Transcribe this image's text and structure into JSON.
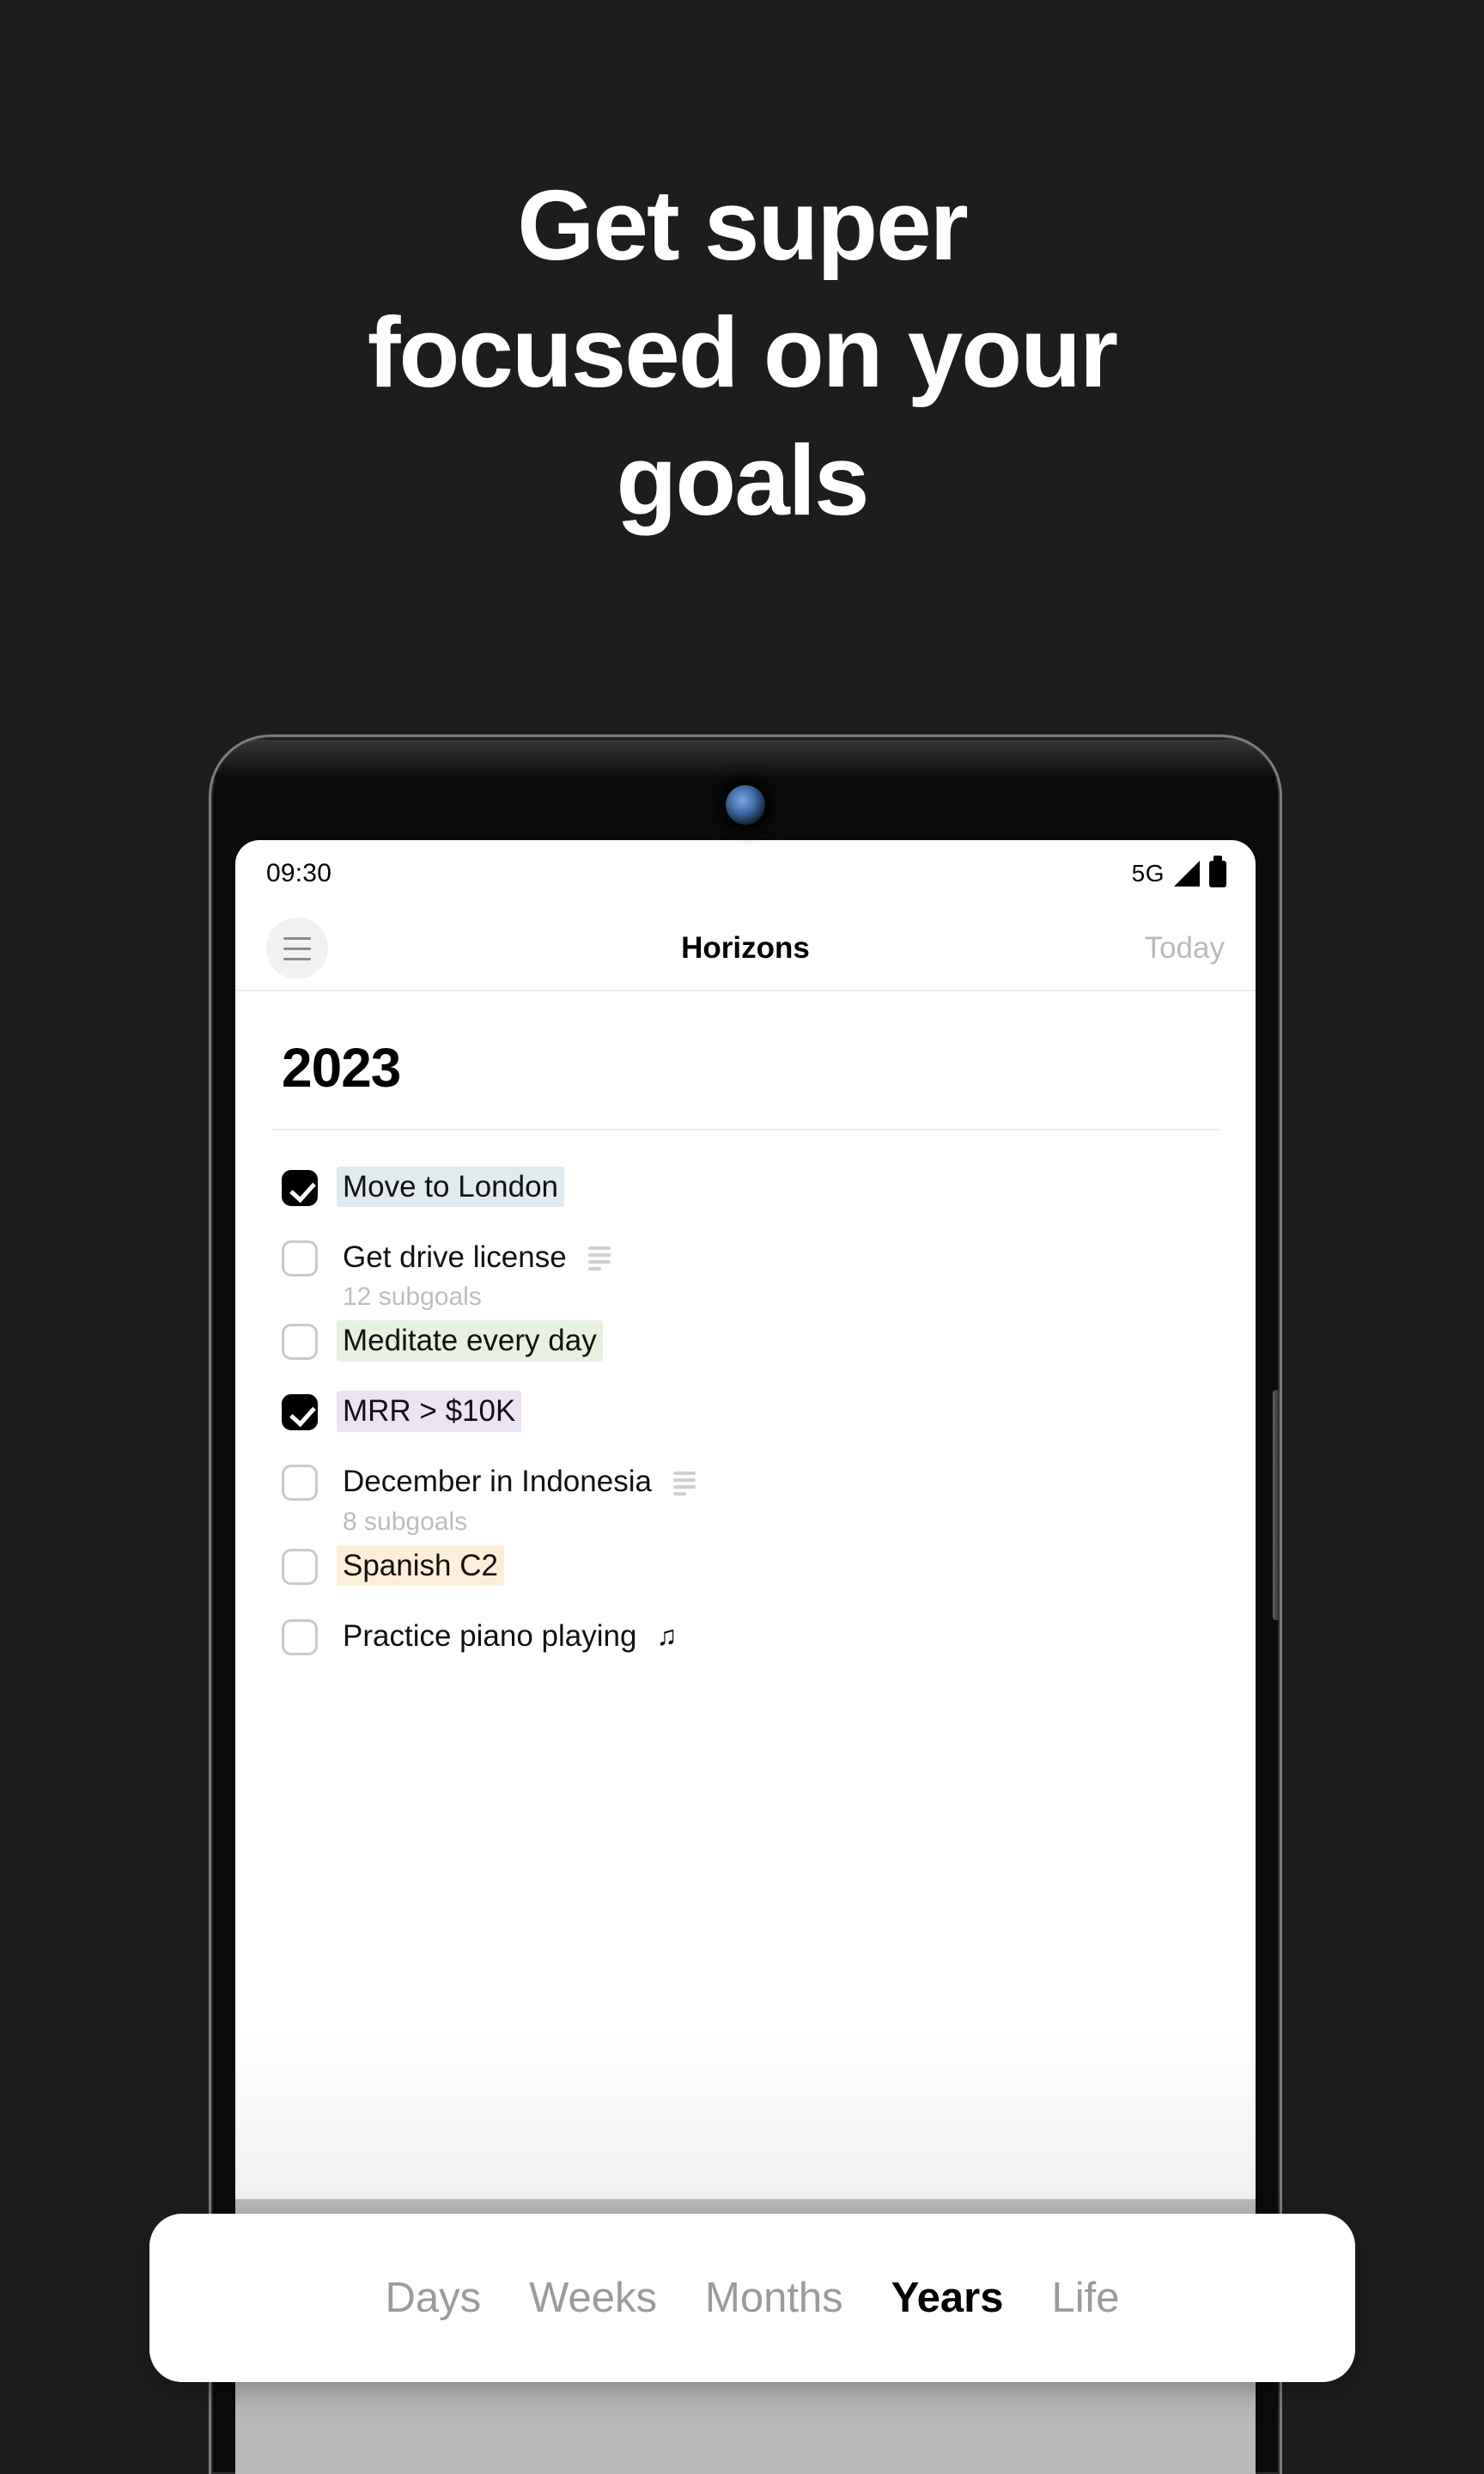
{
  "promo": {
    "headline_lines": [
      "Get super",
      "focused on your",
      "goals"
    ]
  },
  "phone": {
    "status_bar": {
      "time": "09:30",
      "network": "5G",
      "signal_icon": "signal-triangle-icon",
      "battery_icon": "battery-full-icon"
    },
    "nav_bar": {
      "menu_icon": "hamburger-menu-icon",
      "title": "Horizons",
      "action_label": "Today"
    },
    "content": {
      "year": "2023",
      "goals": [
        {
          "label": "Move to London",
          "checked": true,
          "highlight": "hl-blue",
          "subtitle": "",
          "badge": ""
        },
        {
          "label": "Get drive license",
          "checked": false,
          "highlight": "",
          "subtitle": "12 subgoals",
          "badge": "notes-icon"
        },
        {
          "label": "Meditate every day",
          "checked": false,
          "highlight": "hl-green",
          "subtitle": "",
          "badge": ""
        },
        {
          "label": "MRR > $10K",
          "checked": true,
          "highlight": "hl-purple",
          "subtitle": "",
          "badge": ""
        },
        {
          "label": "December in Indonesia",
          "checked": false,
          "highlight": "",
          "subtitle": "8 subgoals",
          "badge": "notes-icon"
        },
        {
          "label": "Spanish C2",
          "checked": false,
          "highlight": "hl-orange",
          "subtitle": "",
          "badge": ""
        },
        {
          "label": "Practice piano playing",
          "checked": false,
          "highlight": "",
          "subtitle": "",
          "badge": "music-note-icon",
          "badge_glyph": "♫"
        }
      ]
    },
    "camera_icon": "front-camera-icon",
    "side_button": "power-button"
  },
  "tabbar": {
    "tabs": [
      {
        "label": "Days",
        "active": false
      },
      {
        "label": "Weeks",
        "active": false
      },
      {
        "label": "Months",
        "active": false
      },
      {
        "label": "Years",
        "active": true
      },
      {
        "label": "Life",
        "active": false
      }
    ]
  },
  "colors": {
    "background": "#1d1d1d",
    "screen": "#ffffff",
    "accent_checked": "#000000",
    "muted_text": "#b9b9b9",
    "highlight_blue": "#e0eaef",
    "highlight_green": "#e7f1e0",
    "highlight_purple": "#ece3f3",
    "highlight_orange": "#fdeed9"
  }
}
